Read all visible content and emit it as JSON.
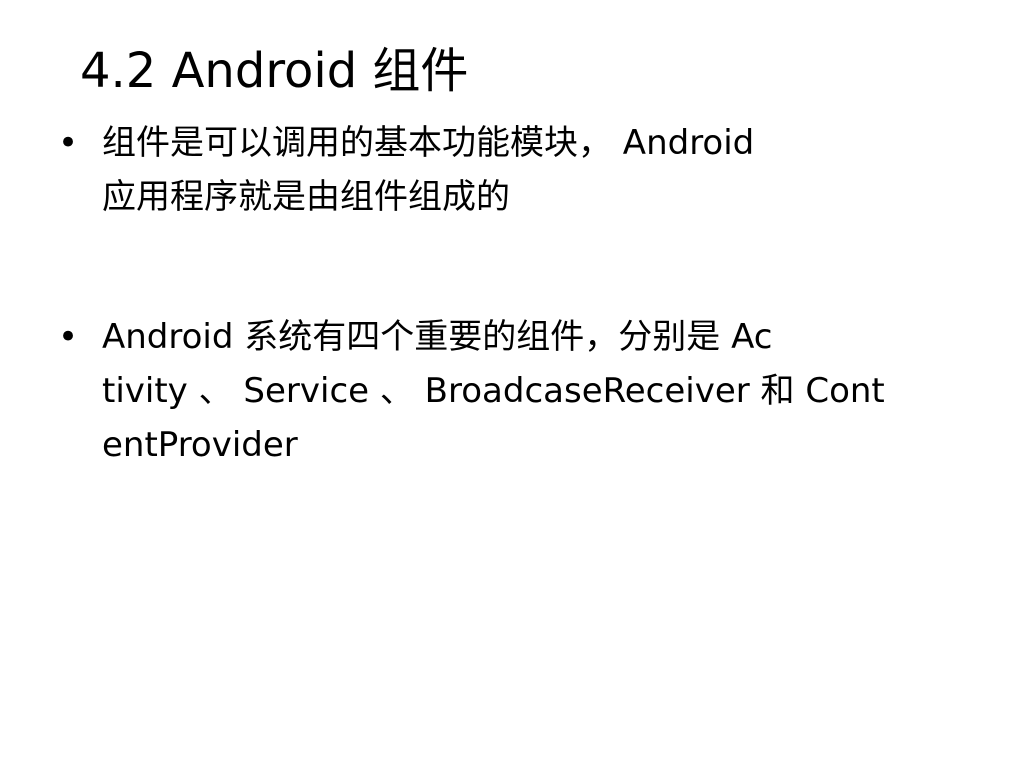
{
  "slide": {
    "title": "4.2 Android 组件",
    "bullets": [
      {
        "marker": "•",
        "lines": [
          "组件是可以调用的基本功能模块， Android",
          "应用程序就是由组件组成的"
        ]
      },
      {
        "marker": "•",
        "lines": [
          "Android 系统有四个重要的组件，分别是 Ac",
          "tivity 、 Service 、 BroadcaseReceiver 和 Cont",
          "entProvider"
        ]
      }
    ]
  }
}
